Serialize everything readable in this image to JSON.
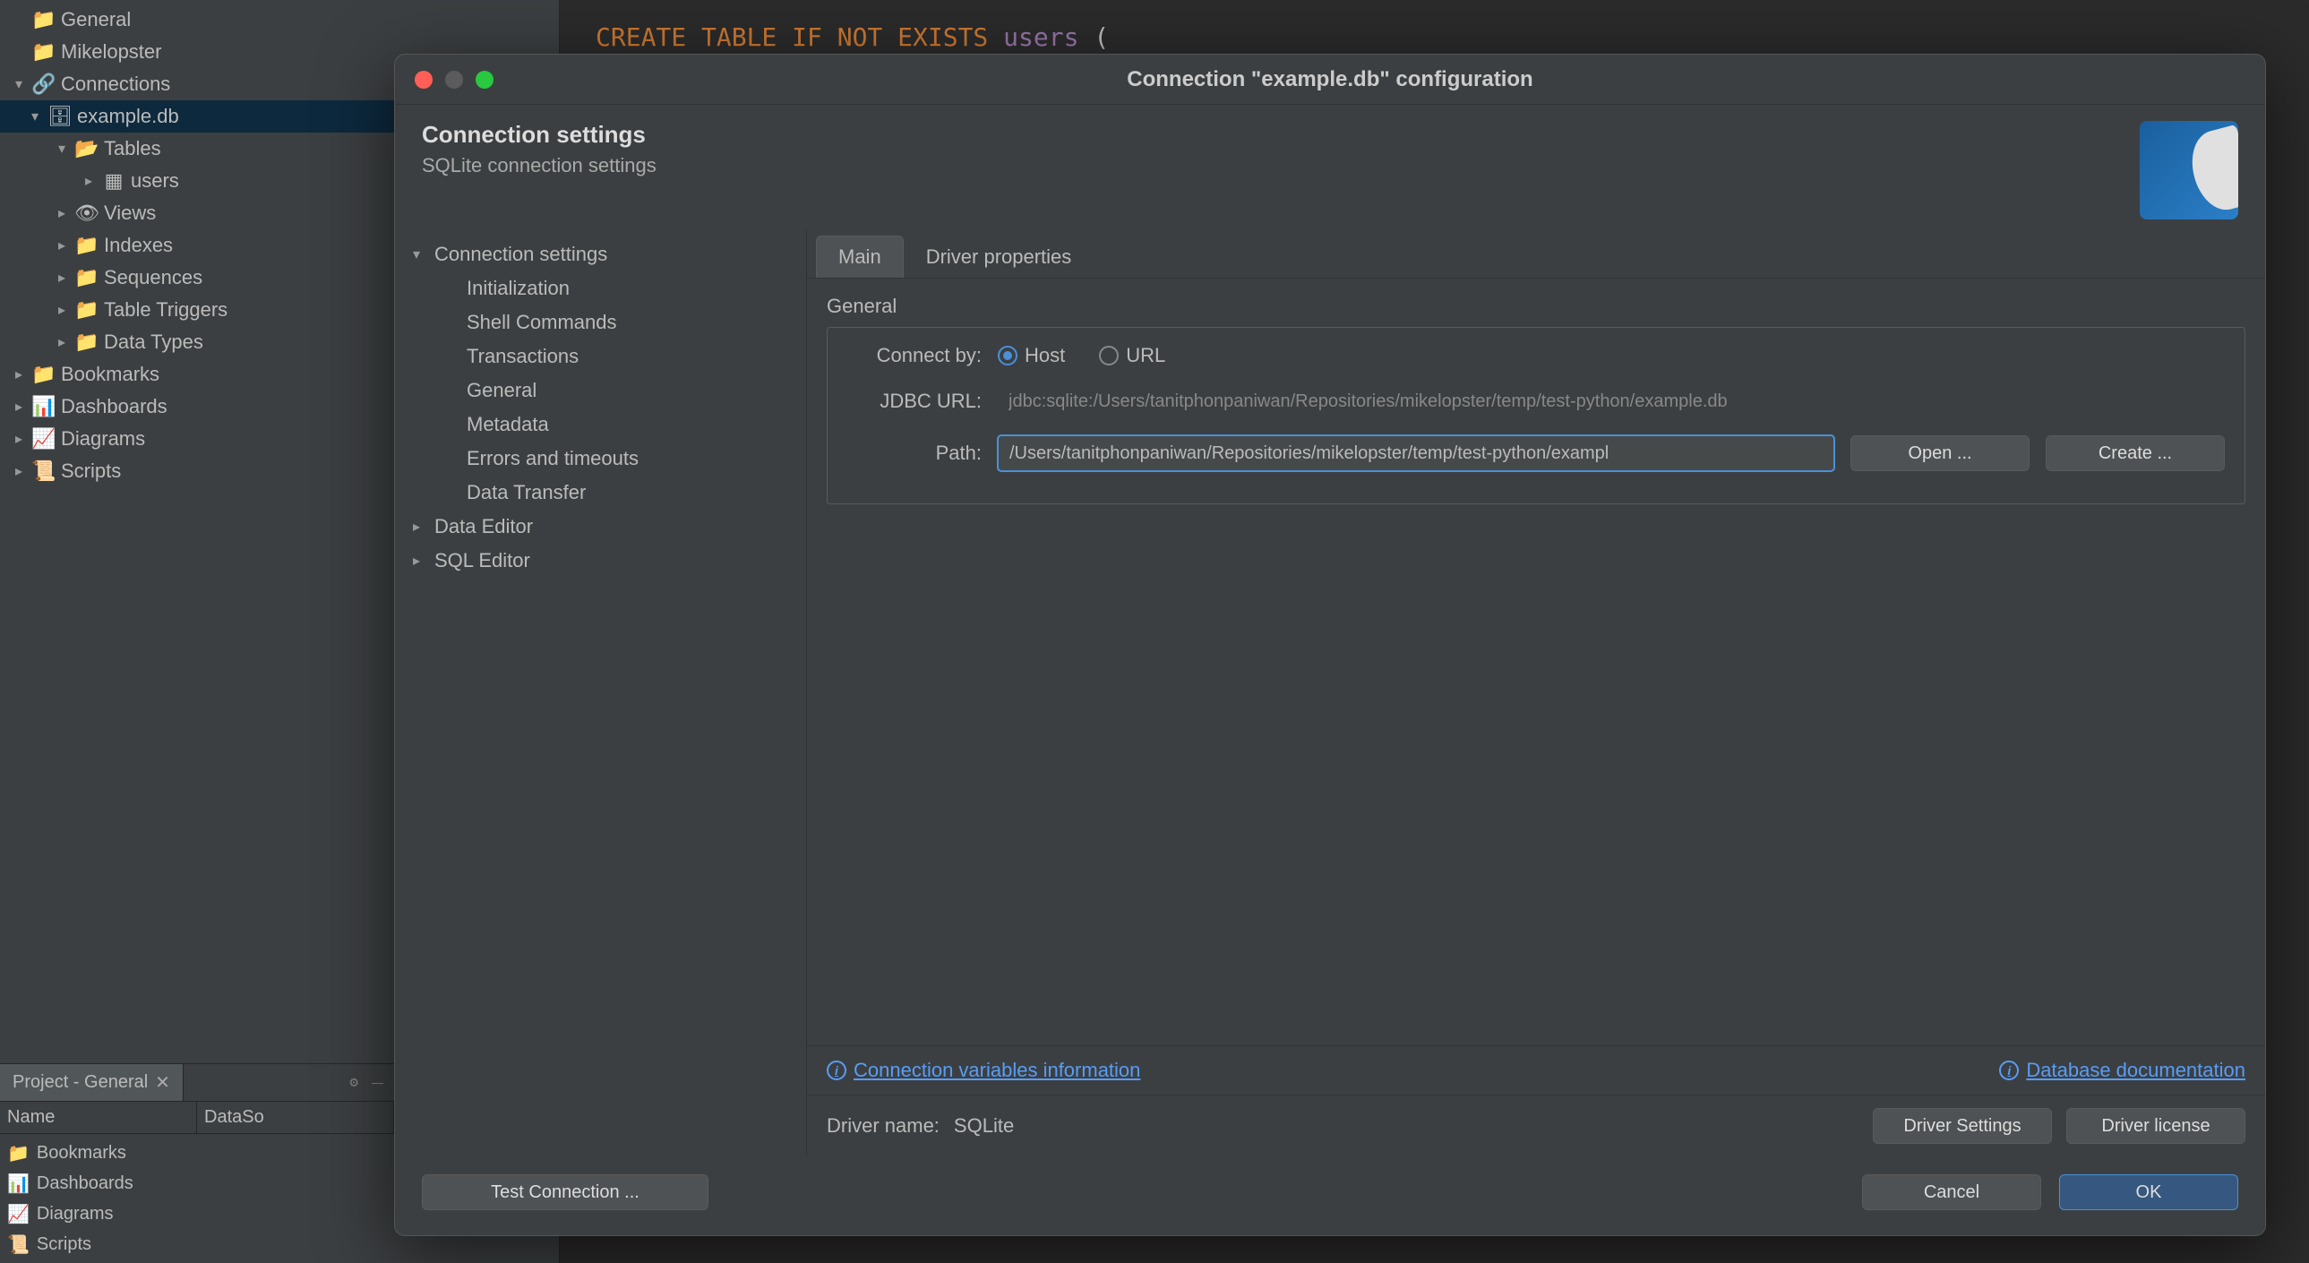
{
  "editor": {
    "line1_prefix": "CREATE TABLE IF NOT EXISTS",
    "line1_table": "users",
    "line1_paren": "("
  },
  "sidebar": {
    "items": [
      {
        "label": "General",
        "indent": 0,
        "arrow": "none",
        "icon": "📁",
        "iconName": "folder-icon"
      },
      {
        "label": "Mikelopster",
        "indent": 0,
        "arrow": "none",
        "icon": "📁",
        "iconName": "folder-icon"
      },
      {
        "label": "Connections",
        "indent": 0,
        "arrow": "down",
        "icon": "🔗",
        "iconName": "connections-icon"
      },
      {
        "label": "example.db",
        "indent": 1,
        "arrow": "down",
        "icon": "🗄",
        "iconName": "database-icon",
        "selected": true
      },
      {
        "label": "Tables",
        "indent": 2,
        "arrow": "down",
        "icon": "📂",
        "iconName": "folder-open-icon"
      },
      {
        "label": "users",
        "indent": 3,
        "arrow": "right",
        "icon": "▦",
        "iconName": "table-icon"
      },
      {
        "label": "Views",
        "indent": 2,
        "arrow": "right",
        "icon": "👁",
        "iconName": "view-icon"
      },
      {
        "label": "Indexes",
        "indent": 2,
        "arrow": "right",
        "icon": "📁",
        "iconName": "folder-gold-icon"
      },
      {
        "label": "Sequences",
        "indent": 2,
        "arrow": "right",
        "icon": "📁",
        "iconName": "folder-gold-icon"
      },
      {
        "label": "Table Triggers",
        "indent": 2,
        "arrow": "right",
        "icon": "📁",
        "iconName": "folder-gold-icon"
      },
      {
        "label": "Data Types",
        "indent": 2,
        "arrow": "right",
        "icon": "📁",
        "iconName": "folder-gold-icon"
      },
      {
        "label": "Bookmarks",
        "indent": 0,
        "arrow": "right",
        "icon": "📁",
        "iconName": "folder-gold-icon"
      },
      {
        "label": "Dashboards",
        "indent": 0,
        "arrow": "right",
        "icon": "📊",
        "iconName": "dashboard-icon"
      },
      {
        "label": "Diagrams",
        "indent": 0,
        "arrow": "right",
        "icon": "📈",
        "iconName": "diagram-icon"
      },
      {
        "label": "Scripts",
        "indent": 0,
        "arrow": "right",
        "icon": "📜",
        "iconName": "script-icon"
      }
    ]
  },
  "project": {
    "tabLabel": "Project - General",
    "col1": "Name",
    "col2": "DataSo",
    "items": [
      {
        "label": "Bookmarks",
        "icon": "📁"
      },
      {
        "label": "Dashboards",
        "icon": "📊"
      },
      {
        "label": "Diagrams",
        "icon": "📈"
      },
      {
        "label": "Scripts",
        "icon": "📜"
      }
    ]
  },
  "dialog": {
    "title": "Connection \"example.db\" configuration",
    "headerTitle": "Connection settings",
    "headerSubtitle": "SQLite connection settings",
    "nav": [
      {
        "label": "Connection settings",
        "arrow": "down",
        "sub": false
      },
      {
        "label": "Initialization",
        "arrow": "",
        "sub": true
      },
      {
        "label": "Shell Commands",
        "arrow": "",
        "sub": true
      },
      {
        "label": "Transactions",
        "arrow": "",
        "sub": true
      },
      {
        "label": "General",
        "arrow": "",
        "sub": true
      },
      {
        "label": "Metadata",
        "arrow": "",
        "sub": true
      },
      {
        "label": "Errors and timeouts",
        "arrow": "",
        "sub": true
      },
      {
        "label": "Data Transfer",
        "arrow": "",
        "sub": true
      },
      {
        "label": "Data Editor",
        "arrow": "right",
        "sub": false
      },
      {
        "label": "SQL Editor",
        "arrow": "right",
        "sub": false
      }
    ],
    "tabs": {
      "main": "Main",
      "driverProperties": "Driver properties"
    },
    "sectionTitle": "General",
    "connectByLabel": "Connect by:",
    "connectByHost": "Host",
    "connectByUrl": "URL",
    "jdbcLabel": "JDBC URL:",
    "jdbcValue": "jdbc:sqlite:/Users/tanitphonpaniwan/Repositories/mikelopster/temp/test-python/example.db",
    "pathLabel": "Path:",
    "pathValue": "/Users/tanitphonpaniwan/Repositories/mikelopster/temp/test-python/exampl",
    "openBtn": "Open ...",
    "createBtn": "Create ...",
    "connectionVarsLink": "Connection variables information",
    "databaseDocLink": "Database documentation",
    "driverNameLabel": "Driver name:",
    "driverNameValue": "SQLite",
    "driverSettingsBtn": "Driver Settings",
    "driverLicenseBtn": "Driver license",
    "testConnBtn": "Test Connection ...",
    "cancelBtn": "Cancel",
    "okBtn": "OK"
  }
}
